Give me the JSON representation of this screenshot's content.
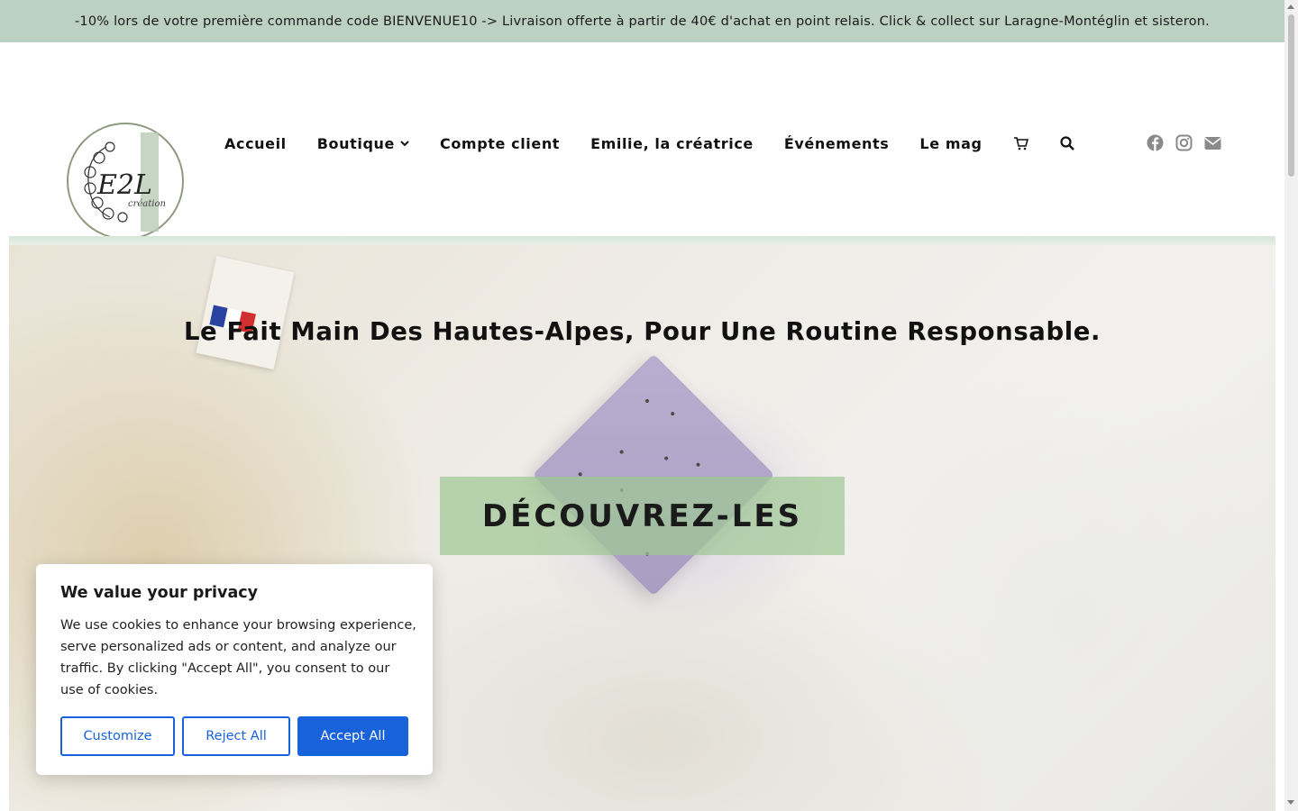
{
  "announcement": {
    "text": "-10% lors de votre première commande code BIENVENUE10 -> Livraison offerte à partir de 40€ d'achat en point relais. Click & collect sur Laragne-Montéglin et sisteron."
  },
  "logo": {
    "text": "E2L",
    "subtext": "création"
  },
  "nav": {
    "items": [
      {
        "label": "Accueil"
      },
      {
        "label": "Boutique"
      },
      {
        "label": "Compte client"
      },
      {
        "label": "Emilie, la créatrice"
      },
      {
        "label": "Événements"
      },
      {
        "label": "Le mag"
      }
    ],
    "cart_icon": "cart-icon",
    "search_icon": "search-icon"
  },
  "social": [
    "facebook-icon",
    "instagram-icon",
    "envelope-icon"
  ],
  "hero": {
    "title": "Le Fait Main Des Hautes-Alpes, Pour Une Routine Responsable.",
    "cta_label": "DÉCOUVREZ-LES"
  },
  "cookie": {
    "title": "We value your privacy",
    "body": "We use cookies to enhance your browsing experience, serve personalized ads or content, and analyze our traffic. By clicking \"Accept All\", you consent to our use of cookies.",
    "customize_label": "Customize",
    "reject_label": "Reject All",
    "accept_label": "Accept All"
  },
  "colors": {
    "announcement_bg": "#bdd1c2",
    "cta_bg": "#a0c896",
    "cookie_accent": "#1863dc"
  }
}
